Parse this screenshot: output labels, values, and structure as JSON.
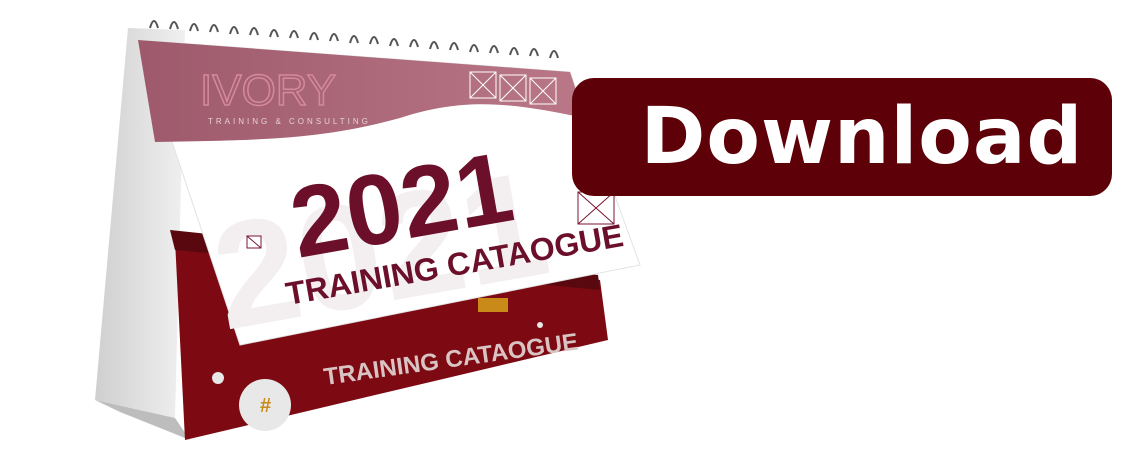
{
  "button": {
    "label": "Download"
  },
  "calendar": {
    "brand": "IVORY",
    "brand_tagline": "TRAINING & CONSULTING",
    "year": "2021",
    "title": "TRAINING CATAOGUE",
    "back_page_title": "TRAINING CATAOGUE",
    "back_page_symbol": "#"
  },
  "colors": {
    "button_bg": "#5e0008",
    "accent_maroon": "#6b0f2a",
    "header_rose": "#a8687a",
    "back_page": "#7d0a12"
  }
}
